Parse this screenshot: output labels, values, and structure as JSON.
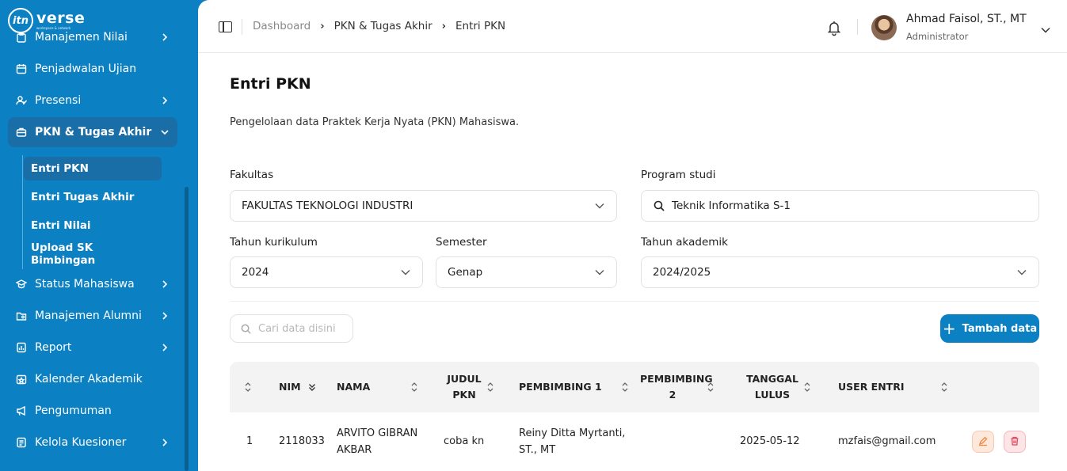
{
  "app": {
    "logo_mark": "itn",
    "logo_word": "verse",
    "logo_sub": "workspace & network"
  },
  "sidebar": {
    "items": [
      {
        "label": "Manajemen Nilai",
        "icon": "clipboard-icon",
        "has_chevron": true
      },
      {
        "label": "Penjadwalan Ujian",
        "icon": "calendar-icon",
        "has_chevron": false
      },
      {
        "label": "Presensi",
        "icon": "user-check-icon",
        "has_chevron": true
      },
      {
        "label": "PKN & Tugas Akhir",
        "icon": "briefcase-icon",
        "has_chevron": true,
        "expanded": true
      },
      {
        "label": "Status Mahasiswa",
        "icon": "graduation-cap-icon",
        "has_chevron": true
      },
      {
        "label": "Manajemen Alumni",
        "icon": "folder-user-icon",
        "has_chevron": true
      },
      {
        "label": "Report",
        "icon": "report-icon",
        "has_chevron": true
      },
      {
        "label": "Kalender Akademik",
        "icon": "calendar-star-icon",
        "has_chevron": false
      },
      {
        "label": "Pengumuman",
        "icon": "megaphone-icon",
        "has_chevron": false
      },
      {
        "label": "Kelola Kuesioner",
        "icon": "questionnaire-icon",
        "has_chevron": true
      }
    ],
    "sub_items": [
      {
        "label": "Entri PKN",
        "active": true
      },
      {
        "label": "Entri Tugas Akhir"
      },
      {
        "label": "Entri Nilai"
      },
      {
        "label": "Upload SK Bimbingan"
      }
    ]
  },
  "header": {
    "breadcrumbs": [
      "Dashboard",
      "PKN & Tugas Akhir",
      "Entri PKN"
    ],
    "user_name": "Ahmad Faisol, ST., MT",
    "user_role": "Administrator"
  },
  "page": {
    "title": "Entri PKN",
    "description": "Pengelolaan data Praktek Kerja Nyata (PKN) Mahasiswa."
  },
  "filters": {
    "fakultas": {
      "label": "Fakultas",
      "value": "FAKULTAS TEKNOLOGI INDUSTRI"
    },
    "prodi": {
      "label": "Program studi",
      "value": "Teknik Informatika S-1"
    },
    "kurikulum": {
      "label": "Tahun kurikulum",
      "value": "2024"
    },
    "semester": {
      "label": "Semester",
      "value": "Genap"
    },
    "akademik": {
      "label": "Tahun akademik",
      "value": "2024/2025"
    }
  },
  "toolbar": {
    "search_placeholder": "Cari data disini",
    "add_label": "Tambah data"
  },
  "table": {
    "columns": {
      "nim": "NIM",
      "nama": "NAMA",
      "judul": "JUDUL PKN",
      "pemb1": "PEMBIMBING 1",
      "pemb2": "PEMBIMBING 2",
      "lulus": "TANGGAL LULUS",
      "user": "USER ENTRI"
    },
    "rows": [
      {
        "no": "1",
        "nim": "2118033",
        "nama": "ARVITO GIBRAN AKBAR",
        "judul": "coba kn",
        "pemb1": "Reiny Ditta Myrtanti, ST., MT",
        "pemb2": "",
        "lulus": "2025-05-12",
        "user": "mzfais@gmail.com"
      }
    ]
  },
  "colors": {
    "brand": "#0b80c3",
    "sidebar_active": "#1a6ea8",
    "edit_bg": "#fde8dc",
    "delete_bg": "#fde4e6"
  }
}
